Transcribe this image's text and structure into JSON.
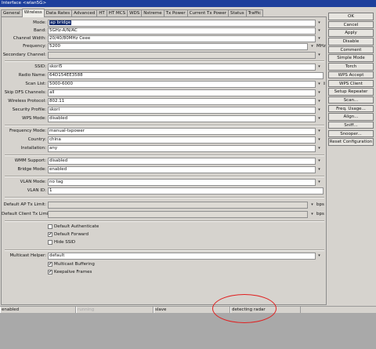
{
  "window": {
    "title": "Interface <wlan5G>"
  },
  "tabs": [
    "General",
    "Wireless",
    "Data Rates",
    "Advanced",
    "HT",
    "HT MCS",
    "WDS",
    "Nstreme",
    "Tx Power",
    "Current Tx Power",
    "Status",
    "Traffic"
  ],
  "active_tab": "Wireless",
  "form": {
    "mode": {
      "label": "Mode:",
      "value": "ap bridge"
    },
    "band": {
      "label": "Band:",
      "value": "5GHz-A/N/AC"
    },
    "channel_width": {
      "label": "Channel Width:",
      "value": "20/40/80MHz Ceee"
    },
    "frequency": {
      "label": "Frequency:",
      "value": "5200",
      "unit": "MHz"
    },
    "secondary_channel": {
      "label": "Secondary Channel:",
      "value": ""
    },
    "ssid": {
      "label": "SSID:",
      "value": "skori5"
    },
    "radio_name": {
      "label": "Radio Name:",
      "value": "64D154EE3588"
    },
    "scan_list": {
      "label": "Scan List:",
      "value": "5000-6000"
    },
    "skip_dfs": {
      "label": "Skip DFS Channels:",
      "value": "all"
    },
    "wireless_protocol": {
      "label": "Wireless Protocol:",
      "value": "802.11"
    },
    "security_profile": {
      "label": "Security Profile:",
      "value": "skori"
    },
    "wps_mode": {
      "label": "WPS Mode:",
      "value": "disabled"
    },
    "frequency_mode": {
      "label": "Frequency Mode:",
      "value": "manual-txpower"
    },
    "country": {
      "label": "Country:",
      "value": "china"
    },
    "installation": {
      "label": "Installation:",
      "value": "any"
    },
    "wmm_support": {
      "label": "WMM Support:",
      "value": "disabled"
    },
    "bridge_mode": {
      "label": "Bridge Mode:",
      "value": "enabled"
    },
    "vlan_mode": {
      "label": "VLAN Mode:",
      "value": "no tag"
    },
    "vlan_id": {
      "label": "VLAN ID:",
      "value": "1"
    },
    "default_ap_tx_limit": {
      "label": "Default AP Tx Limit:",
      "value": "",
      "unit": "bps"
    },
    "default_client_tx_limit": {
      "label": "Default Client Tx Limit:",
      "value": "",
      "unit": "bps"
    },
    "default_authenticate": {
      "label": "Default Authenticate",
      "checked": false
    },
    "default_forward": {
      "label": "Default Forward",
      "checked": true
    },
    "hide_ssid": {
      "label": "Hide SSID",
      "checked": false
    },
    "multicast_helper": {
      "label": "Multicast Helper:",
      "value": "default"
    },
    "multicast_buffering": {
      "label": "Multicast Buffering",
      "checked": true
    },
    "keepalive_frames": {
      "label": "Keepalive Frames",
      "checked": true
    }
  },
  "buttons": [
    "OK",
    "Cancel",
    "Apply",
    "Disable",
    "Comment",
    "Simple Mode",
    "Torch",
    "WPS Accept",
    "WPS Client",
    "Setup Repeater",
    "Scan...",
    "Freq. Usage...",
    "Align...",
    "Sniff...",
    "Snooper...",
    "Reset Configuration"
  ],
  "status": {
    "s1": "enabled",
    "s2": "running",
    "s3": "slave",
    "s4": "detecting radar"
  },
  "checkmark": "✔",
  "dropdown_glyph": "▾",
  "updown_glyph": "⇕",
  "colors": {
    "title_bar": "#1d3f9c",
    "annotation": "#e02020",
    "selection": "#0a246a"
  }
}
